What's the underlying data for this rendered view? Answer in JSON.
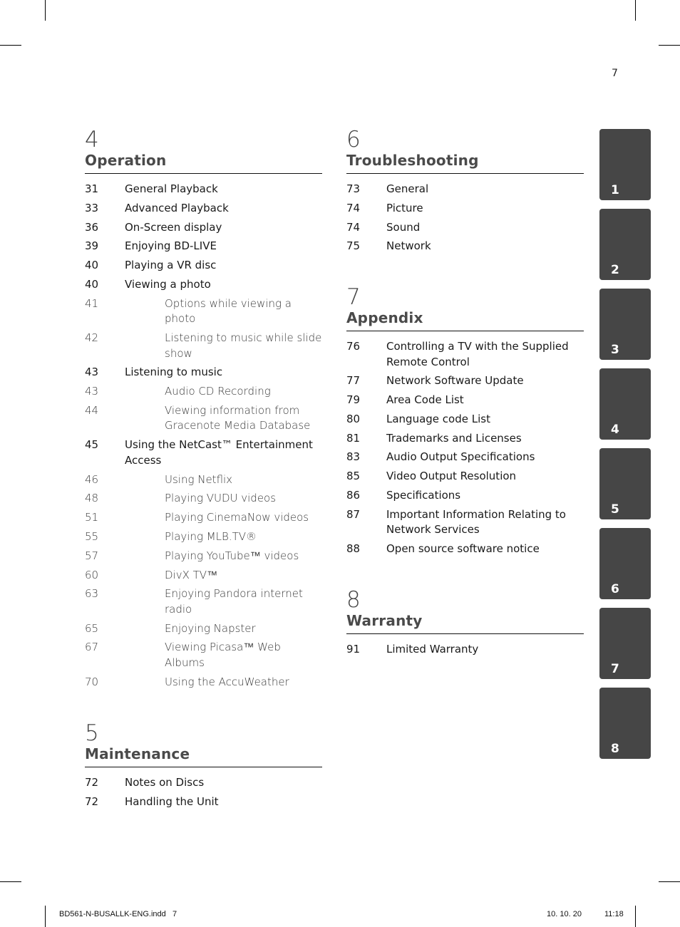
{
  "page_number": "7",
  "sections": [
    {
      "number": "4",
      "title": "Operation",
      "entries": [
        {
          "page": "31",
          "title": "General Playback",
          "level": "main"
        },
        {
          "page": "33",
          "title": "Advanced Playback",
          "level": "main"
        },
        {
          "page": "36",
          "title": "On-Screen display",
          "level": "main"
        },
        {
          "page": "39",
          "title": "Enjoying BD-LIVE",
          "level": "main"
        },
        {
          "page": "40",
          "title": "Playing a VR disc",
          "level": "main"
        },
        {
          "page": "40",
          "title": "Viewing a photo",
          "level": "main"
        },
        {
          "page": "41",
          "title": "Options while viewing a photo",
          "level": "sub"
        },
        {
          "page": "42",
          "title": "Listening to music while slide show",
          "level": "sub"
        },
        {
          "page": "43",
          "title": "Listening to music",
          "level": "main"
        },
        {
          "page": "43",
          "title": "Audio CD Recording",
          "level": "sub"
        },
        {
          "page": "44",
          "title": "Viewing information from Gracenote Media Database",
          "level": "sub"
        },
        {
          "page": "45",
          "title": "Using the NetCast™ Entertainment Access",
          "level": "main"
        },
        {
          "page": "46",
          "title": "Using Netflix",
          "level": "sub"
        },
        {
          "page": "48",
          "title": "Playing VUDU videos",
          "level": "sub"
        },
        {
          "page": "51",
          "title": "Playing CinemaNow videos",
          "level": "sub"
        },
        {
          "page": "55",
          "title": "Playing MLB.TV®",
          "level": "sub"
        },
        {
          "page": "57",
          "title": "Playing YouTube™ videos",
          "level": "sub"
        },
        {
          "page": "60",
          "title": "DivX TV™",
          "level": "sub"
        },
        {
          "page": "63",
          "title": "Enjoying Pandora internet radio",
          "level": "sub"
        },
        {
          "page": "65",
          "title": "Enjoying Napster",
          "level": "sub"
        },
        {
          "page": "67",
          "title": "Viewing Picasa™ Web Albums",
          "level": "sub"
        },
        {
          "page": "70",
          "title": "Using the AccuWeather",
          "level": "sub"
        }
      ]
    },
    {
      "number": "5",
      "title": "Maintenance",
      "entries": [
        {
          "page": "72",
          "title": "Notes on Discs",
          "level": "main"
        },
        {
          "page": "72",
          "title": "Handling the Unit",
          "level": "main"
        }
      ]
    },
    {
      "number": "6",
      "title": "Troubleshooting",
      "entries": [
        {
          "page": "73",
          "title": "General",
          "level": "main"
        },
        {
          "page": "74",
          "title": "Picture",
          "level": "main"
        },
        {
          "page": "74",
          "title": "Sound",
          "level": "main"
        },
        {
          "page": "75",
          "title": "Network",
          "level": "main"
        }
      ]
    },
    {
      "number": "7",
      "title": "Appendix",
      "entries": [
        {
          "page": "76",
          "title": "Controlling a TV with the Supplied Remote Control",
          "level": "main"
        },
        {
          "page": "77",
          "title": "Network Software Update",
          "level": "main"
        },
        {
          "page": "79",
          "title": "Area Code List",
          "level": "main"
        },
        {
          "page": "80",
          "title": "Language code List",
          "level": "main"
        },
        {
          "page": "81",
          "title": "Trademarks and Licenses",
          "level": "main"
        },
        {
          "page": "83",
          "title": "Audio Output Specifications",
          "level": "main"
        },
        {
          "page": "85",
          "title": "Video Output Resolution",
          "level": "main"
        },
        {
          "page": "86",
          "title": "Specifications",
          "level": "main"
        },
        {
          "page": "87",
          "title": "Important Information Relating to Network Services",
          "level": "main"
        },
        {
          "page": "88",
          "title": "Open source software notice",
          "level": "main"
        }
      ]
    },
    {
      "number": "8",
      "title": "Warranty",
      "entries": [
        {
          "page": "91",
          "title": "Limited Warranty",
          "level": "main"
        }
      ]
    }
  ],
  "chapter_tabs": [
    "1",
    "2",
    "3",
    "4",
    "5",
    "6",
    "7",
    "8"
  ],
  "colors": {
    "tab_background": "#464646",
    "tab_text": "#ffffff",
    "heading": "#4a4a4a"
  },
  "footer": {
    "file_name": "BD561-N-BUSALLK-ENG.indd   7",
    "date": "10. 10. 20",
    "time": "11:18"
  }
}
